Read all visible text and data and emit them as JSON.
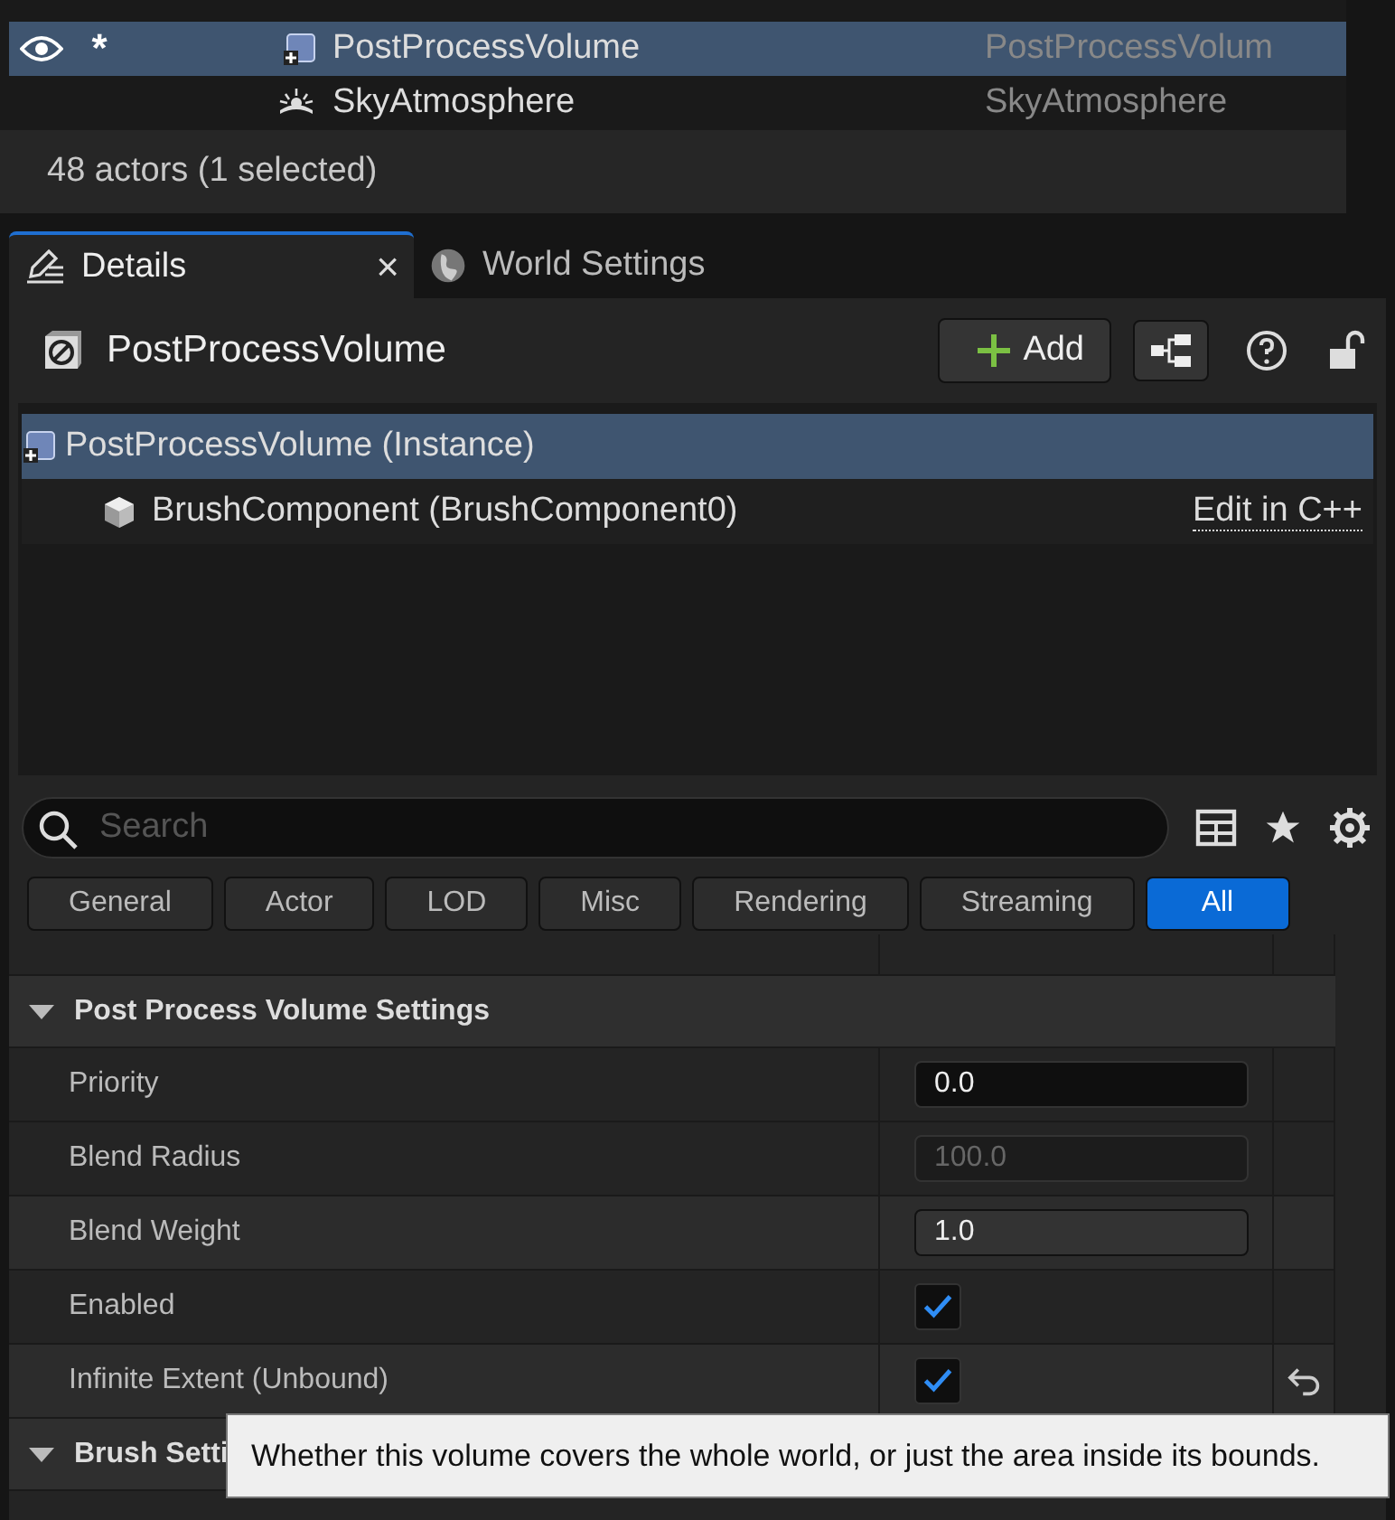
{
  "outliner": {
    "rows": [
      {
        "label": "PostProcessVolume",
        "type": "PostProcessVolum",
        "visible": true,
        "modified_mark": "*",
        "selected": true
      },
      {
        "label": "SkyAtmosphere",
        "type": "SkyAtmosphere",
        "visible": false,
        "selected": false
      }
    ],
    "status": "48 actors (1 selected)"
  },
  "tabs": [
    {
      "label": "Details",
      "close": "×",
      "selected": true
    },
    {
      "label": "World Settings",
      "selected": false
    }
  ],
  "details": {
    "title": "PostProcessVolume",
    "add_label": "Add",
    "components": [
      {
        "label": "PostProcessVolume (Instance)",
        "selected": true,
        "children": [
          {
            "label": "BrushComponent (BrushComponent0)",
            "link": "Edit in C++",
            "selected": false
          }
        ]
      }
    ],
    "search": {
      "placeholder": "Search"
    },
    "filters": [
      {
        "label": "General",
        "selected": false
      },
      {
        "label": "Actor",
        "selected": false
      },
      {
        "label": "LOD",
        "selected": false
      },
      {
        "label": "Misc",
        "selected": false
      },
      {
        "label": "Rendering",
        "selected": false
      },
      {
        "label": "Streaming",
        "selected": false
      },
      {
        "label": "All",
        "selected": true
      }
    ],
    "categories": [
      {
        "title": "Post Process Volume Settings",
        "expanded": true,
        "properties": [
          {
            "kind": "number",
            "label": "Priority",
            "value": "0.0",
            "disabled": false,
            "hovered": false
          },
          {
            "kind": "number",
            "label": "Blend Radius",
            "value": "100.0",
            "disabled": true,
            "hovered": false
          },
          {
            "kind": "number",
            "label": "Blend Weight",
            "value": "1.0",
            "disabled": false,
            "hovered": true
          },
          {
            "kind": "checkbox",
            "label": "Enabled",
            "checked": true,
            "hovered": false
          },
          {
            "kind": "checkbox",
            "label": "Infinite Extent (Unbound)",
            "checked": true,
            "hovered": true,
            "resettable": true
          }
        ]
      },
      {
        "title": "Brush Setti",
        "expanded": true
      }
    ]
  },
  "tooltip": {
    "text": "Whether this volume covers the whole world, or just the area inside its bounds."
  }
}
